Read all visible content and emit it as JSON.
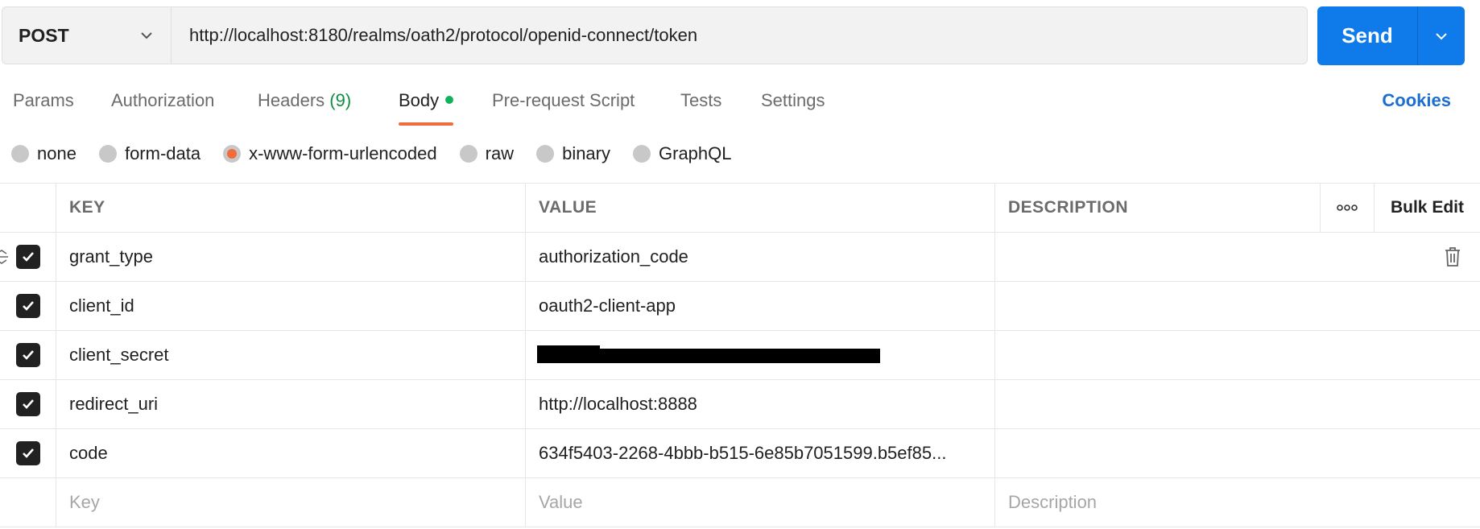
{
  "request": {
    "method": "POST",
    "url": "http://localhost:8180/realms/oath2/protocol/openid-connect/token",
    "send_label": "Send"
  },
  "tabs": [
    {
      "label": "Params"
    },
    {
      "label": "Authorization"
    },
    {
      "label": "Headers",
      "count": "(9)"
    },
    {
      "label": "Body"
    },
    {
      "label": "Pre-request Script"
    },
    {
      "label": "Tests"
    },
    {
      "label": "Settings"
    }
  ],
  "cookies_label": "Cookies",
  "body_types": [
    "none",
    "form-data",
    "x-www-form-urlencoded",
    "raw",
    "binary",
    "GraphQL"
  ],
  "body_type_selected": "x-www-form-urlencoded",
  "table": {
    "headers": {
      "key": "KEY",
      "value": "VALUE",
      "description": "DESCRIPTION",
      "bulk_edit": "Bulk Edit"
    },
    "rows": [
      {
        "key": "grant_type",
        "value": "authorization_code",
        "checked": true
      },
      {
        "key": "client_id",
        "value": "oauth2-client-app",
        "checked": true
      },
      {
        "key": "client_secret",
        "value": "",
        "checked": true,
        "redacted": true
      },
      {
        "key": "redirect_uri",
        "value": "http://localhost:8888",
        "checked": true
      },
      {
        "key": "code",
        "value": "634f5403-2268-4bbb-b515-6e85b7051599.b5ef85...",
        "checked": true
      }
    ],
    "placeholders": {
      "key": "Key",
      "value": "Value",
      "description": "Description"
    }
  },
  "colors": {
    "send": "#0f7bea",
    "active_tab_underline": "#f26b3a",
    "body_dot": "#0fb35b",
    "headers_count": "#0f8f43",
    "cookies": "#1a6fcf"
  }
}
